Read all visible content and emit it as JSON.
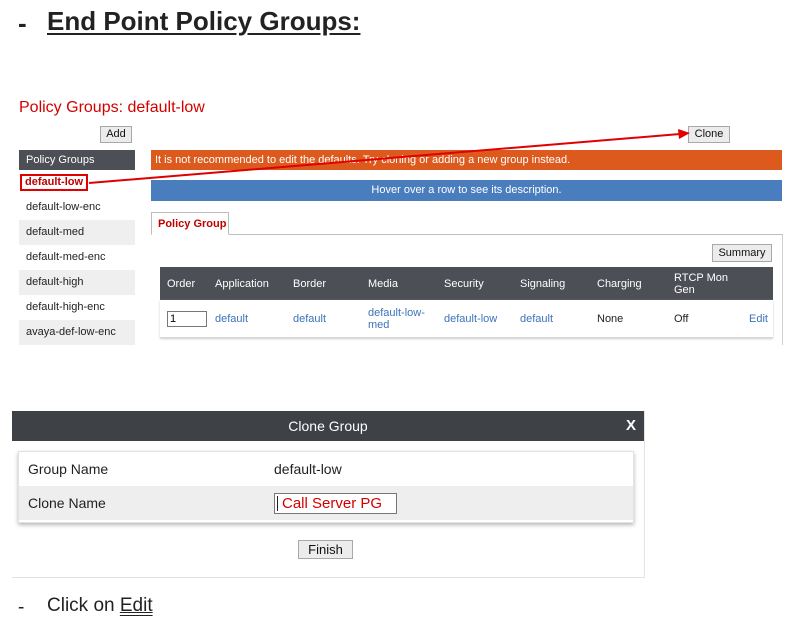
{
  "heading": {
    "dash": "-",
    "title": "End Point Policy Groups:"
  },
  "policy": {
    "title": "Policy Groups: default-low",
    "add_label": "Add",
    "clone_label": "Clone",
    "warning": "It is not recommended to edit the defaults. Try cloning or adding a new group instead.",
    "hover_hint": "Hover over a row to see its description.",
    "tab": "Policy Group",
    "summary_label": "Summary"
  },
  "sidebar": {
    "header": "Policy Groups",
    "items": [
      {
        "label": "default-low"
      },
      {
        "label": "default-low-enc"
      },
      {
        "label": "default-med"
      },
      {
        "label": "default-med-enc"
      },
      {
        "label": "default-high"
      },
      {
        "label": "default-high-enc"
      },
      {
        "label": "avaya-def-low-enc"
      }
    ]
  },
  "grid": {
    "columns": [
      "Order",
      "Application",
      "Border",
      "Media",
      "Security",
      "Signaling",
      "Charging",
      "RTCP Mon Gen"
    ],
    "row": {
      "order": "1",
      "application": "default",
      "border": "default",
      "media": "default-low-med",
      "security": "default-low",
      "signaling": "default",
      "charging": "None",
      "rtcp": "Off",
      "edit": "Edit"
    }
  },
  "dialog": {
    "title": "Clone Group",
    "close": "X",
    "group_name_label": "Group Name",
    "group_name_value": "default-low",
    "clone_name_label": "Clone Name",
    "clone_name_value": "Call Server PG",
    "finish_label": "Finish"
  },
  "step": {
    "dash": "-",
    "text": "Click on ",
    "link": "Edit"
  },
  "colors": {
    "accent_red": "#d40000",
    "warning_orange": "#dd5a1f",
    "hint_blue": "#4a7dbd",
    "header_dark": "#4c4f55"
  }
}
